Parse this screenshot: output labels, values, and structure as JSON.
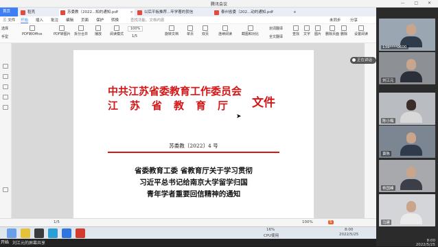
{
  "window": {
    "title": "腾讯会议",
    "controls": "— □ ✕"
  },
  "tabs": {
    "home": "首页",
    "items": [
      {
        "label": "稻壳"
      },
      {
        "label": "苏委教〔2022...知的通知.pdf"
      },
      {
        "label": "以后平板推荐...年学著的贺信"
      },
      {
        "label": "泰州省委〔202...动的通知.pdf"
      }
    ],
    "plus": "+"
  },
  "menu": {
    "items": [
      "三 文件",
      "开始",
      "插入",
      "批注",
      "编辑",
      "页面",
      "保护",
      "转换"
    ],
    "selected_index": 1,
    "search_placeholder": "查找功能、文档内容",
    "right_items": [
      "未同步",
      "分享"
    ]
  },
  "toolbar": {
    "big_buttons": [
      "手型",
      "选择",
      "PDF转Office",
      "PDF转图片",
      "拆分合并",
      "播放",
      "阅读模式",
      "旋转文档",
      "单页",
      "双页",
      "连续阅读",
      "截图和对比",
      "查找",
      "文字",
      "图片",
      "插入页面",
      "删除页面",
      "插入书签",
      "删除",
      "设置阅读"
    ],
    "zoom": "100%",
    "page_indicator": "1/5",
    "right_items": [
      "划词翻译",
      "全文翻译"
    ]
  },
  "document": {
    "org_line1": "中共江苏省委教育工作委员会",
    "org_line2": "江苏省教育厅",
    "wenjian": "文件",
    "doc_number": "苏委教〔2022〕4 号",
    "title_line1": "省委教育工委  省教育厅关于学习贯彻",
    "title_line2": "习近平总书记给南京大学留学归国",
    "title_line3": "青年学者重要回信精神的通知"
  },
  "statusbar": {
    "page": "1/5",
    "zoom": "100%",
    "extra": "S"
  },
  "taskbar": {
    "cpu_label": "16%",
    "cpu_text": "CPU使用",
    "time": "8:00",
    "date": "2022/5/25"
  },
  "share": {
    "message": "刘江元的屏幕共享",
    "start_label": "开始",
    "mic_label": "正在讲话"
  },
  "participants": [
    {
      "name": "139****0600"
    },
    {
      "name": "刘江元"
    },
    {
      "name": "陈小梅"
    },
    {
      "name": "萧陈"
    },
    {
      "name": "杨国峰"
    },
    {
      "name": "马建"
    }
  ],
  "clock": {
    "time": "8:00",
    "date": "2022/5/25"
  },
  "colors": {
    "accent": "#3f7ff5",
    "doc_red": "#d51515",
    "side_bg": "#2b2b2b"
  }
}
